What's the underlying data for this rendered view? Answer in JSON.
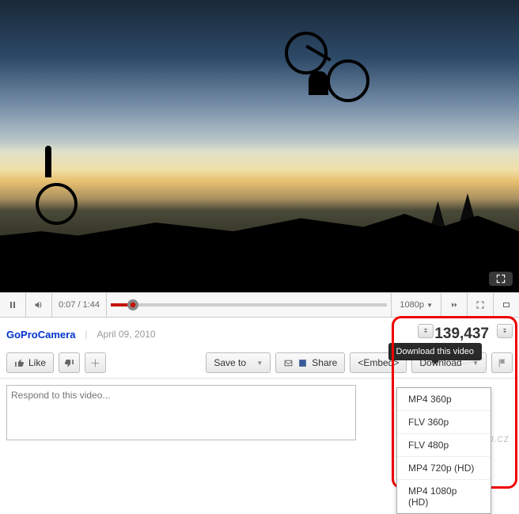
{
  "channel": {
    "name": "GoProCamera",
    "upload_date": "April 09, 2010"
  },
  "views": "139,437",
  "player": {
    "current_time": "0:07",
    "duration": "1:44",
    "quality": "1080p",
    "quality_caret": "▼"
  },
  "actions": {
    "like": "Like",
    "save_to": "Save to",
    "save_caret": "▼",
    "share": "Share",
    "embed": "<Embed>",
    "download": "Download",
    "download_caret": "▼"
  },
  "tooltip": {
    "download": "Download this video"
  },
  "download_options": [
    "MP4 360p",
    "FLV 360p",
    "FLV 480p",
    "MP4 720p (HD)",
    "MP4 1080p (HD)"
  ],
  "comment": {
    "placeholder": "Respond to this video..."
  },
  "watermark": "INSTALUJ.CZ"
}
